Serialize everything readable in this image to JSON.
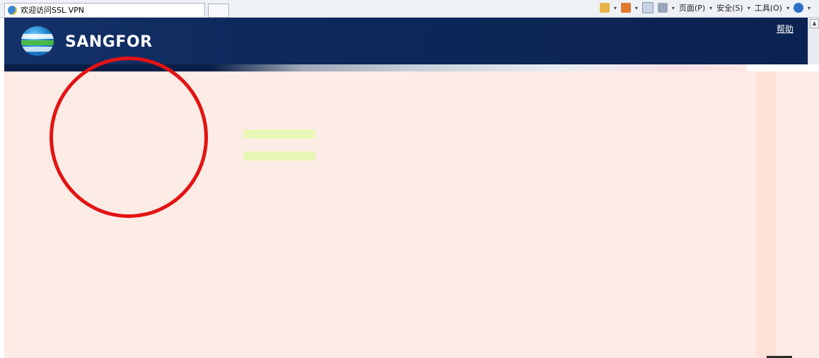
{
  "browser": {
    "tab_title": "欢迎访问SSL VPN",
    "menu": {
      "page": "页面(P)",
      "safety": "安全(S)",
      "tools": "工具(O)"
    },
    "icons": [
      "home-icon",
      "feeds-icon",
      "mail-icon",
      "print-icon",
      "help-icon"
    ]
  },
  "header": {
    "brand": "SANGFOR",
    "help_link": "帮助"
  },
  "colors": {
    "header_bg": "#0d285a",
    "page_bg": "#fdebe6",
    "annotation_circle": "#e31313"
  }
}
